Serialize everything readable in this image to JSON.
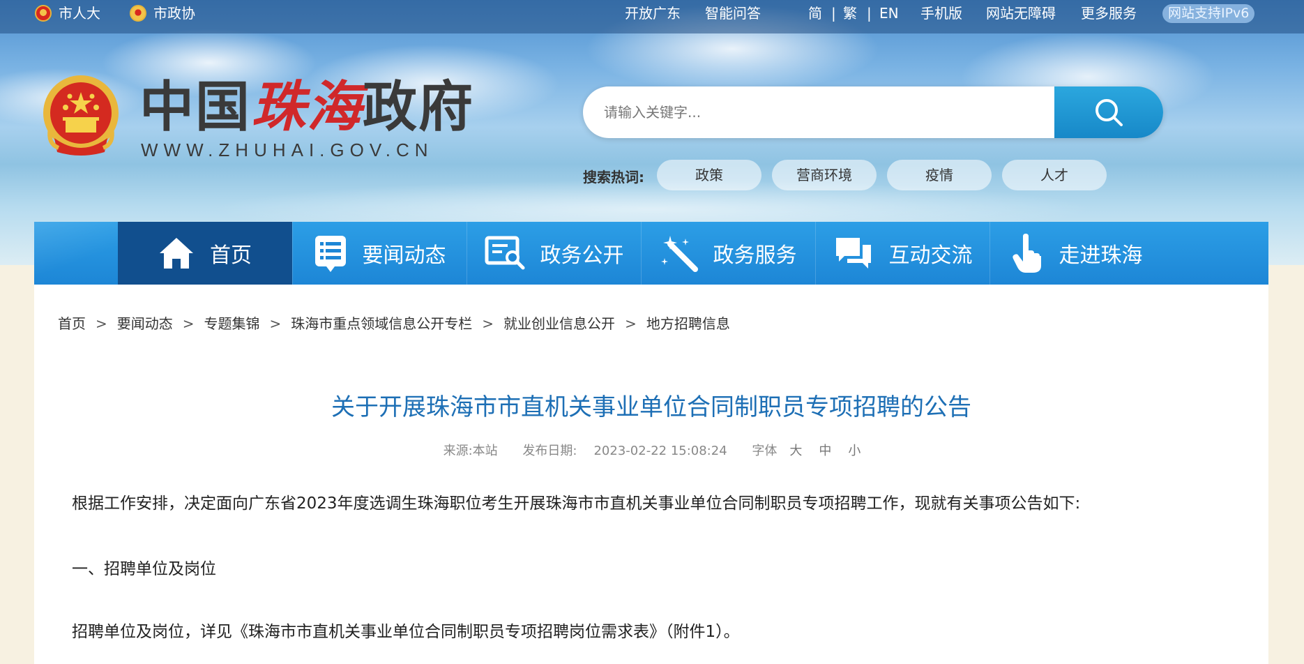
{
  "topbar": {
    "left_links": [
      {
        "label": "市人大",
        "icon": "emblem-icon"
      },
      {
        "label": "市政协",
        "icon": "cppcc-emblem-icon"
      }
    ],
    "right_links": [
      "开放广东",
      "智能问答",
      "简",
      "|",
      "繁",
      "|",
      "EN",
      "手机版",
      "网站无障碍",
      "更多服务"
    ],
    "ipv6_badge": "网站支持IPv6"
  },
  "header": {
    "site_name_prefix": "中国",
    "site_name_accent": "珠海",
    "site_name_suffix": "政府",
    "domain": "WWW.ZHUHAI.GOV.CN",
    "logo_icon": "national-emblem-icon"
  },
  "search": {
    "placeholder": "请输入关键字...",
    "button_icon": "search-icon",
    "hot_label": "搜索热词:",
    "hot_words": [
      "政策",
      "营商环境",
      "疫情",
      "人才"
    ]
  },
  "nav": {
    "items": [
      {
        "label": "首页",
        "icon": "home-icon",
        "active": true
      },
      {
        "label": "要闻动态",
        "icon": "list-icon",
        "active": false
      },
      {
        "label": "政务公开",
        "icon": "document-search-icon",
        "active": false
      },
      {
        "label": "政务服务",
        "icon": "magic-wand-icon",
        "active": false
      },
      {
        "label": "互动交流",
        "icon": "chat-icon",
        "active": false
      },
      {
        "label": "走进珠海",
        "icon": "hand-pointer-icon",
        "active": false
      }
    ]
  },
  "breadcrumb": [
    "首页",
    "要闻动态",
    "专题集锦",
    "珠海市重点领域信息公开专栏",
    "就业创业信息公开",
    "地方招聘信息"
  ],
  "article": {
    "title": "关于开展珠海市市直机关事业单位合同制职员专项招聘的公告",
    "source_label": "来源:本站",
    "date_label": "发布日期:",
    "date": "2023-02-22 15:08:24",
    "font_label": "字体",
    "font_sizes": [
      "大",
      "中",
      "小"
    ],
    "paragraphs": [
      "根据工作安排，决定面向广东省2023年度选调生珠海职位考生开展珠海市市直机关事业单位合同制职员专项招聘工作，现就有关事项公告如下:",
      "一、招聘单位及岗位",
      "招聘单位及岗位，详见《珠海市市直机关事业单位合同制职员专项招聘岗位需求表》（附件1）。"
    ]
  },
  "colors": {
    "nav_bg": "#1d86d6",
    "nav_active": "#114f8e",
    "title": "#1d6fb5",
    "search_btn": "#1788c8",
    "page_bg": "#f7f1e1"
  }
}
